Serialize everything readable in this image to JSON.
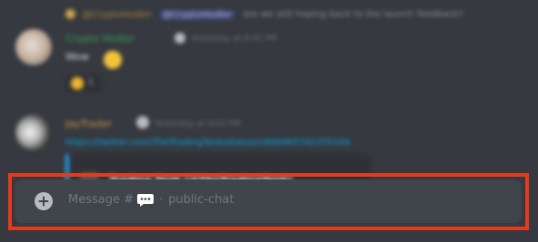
{
  "messages": [
    {
      "reply_user": "@CryptoHodler",
      "reply_mention": "@CryptoHodler",
      "reply_text": "are we still hoping back to the launch feedback?",
      "author": "Crypto Hodler",
      "timestamp": "Yesterday at 8:41 PM",
      "text": "Wow",
      "reaction_count": "1"
    },
    {
      "author": "JayTrader",
      "timestamp": "Yesterday at 9:02 PM",
      "link": "https://twitter.com/TheTradingTank/status/1609483742375104",
      "embed_title": "Trading Tank (@TheTradingTank)"
    }
  ],
  "composer": {
    "placeholder_prefix": "Message #",
    "channel_separator": "·",
    "channel_name": "public-chat",
    "attach_icon": "plus-circle-icon",
    "channel_icon": "chat-bubble-icon"
  },
  "colors": {
    "background": "#36393f",
    "composer_bg": "#40444b",
    "placeholder": "#72767d",
    "highlight": "#e53a1e"
  }
}
